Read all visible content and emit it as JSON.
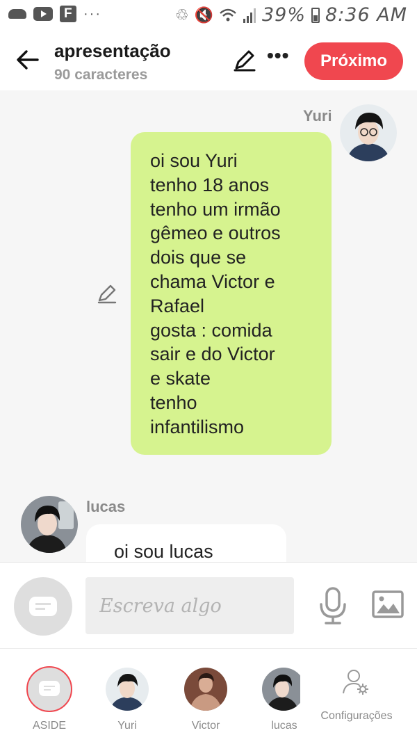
{
  "status_bar": {
    "battery": "39%",
    "time": "8:36 AM",
    "notification_icons": [
      "cloud-icon",
      "youtube-icon",
      "flipboard-icon"
    ]
  },
  "header": {
    "title": "apresentação",
    "subtitle": "90 caracteres",
    "next_label": "Próximo",
    "accent_color": "#f0474f"
  },
  "chat": {
    "messages": [
      {
        "sender": "Yuri",
        "text": "oi sou Yuri\ntenho 18 anos\ntenho um irmão\ngêmeo e outros\ndois que se\nchama Victor e\nRafael\ngosta : comida\nsair e do Victor\ne skate\ntenho\ninfantilismo",
        "bubble_color": "#d6f38f"
      },
      {
        "sender": "lucas",
        "text": "oi sou lucas",
        "bubble_color": "#ffffff"
      }
    ]
  },
  "composer": {
    "placeholder": "Escreva algo"
  },
  "bottom_nav": {
    "tabs": [
      {
        "label": "ASIDE"
      },
      {
        "label": "Yuri"
      },
      {
        "label": "Victor"
      },
      {
        "label": "lucas"
      },
      {
        "label": "Configurações"
      }
    ]
  }
}
